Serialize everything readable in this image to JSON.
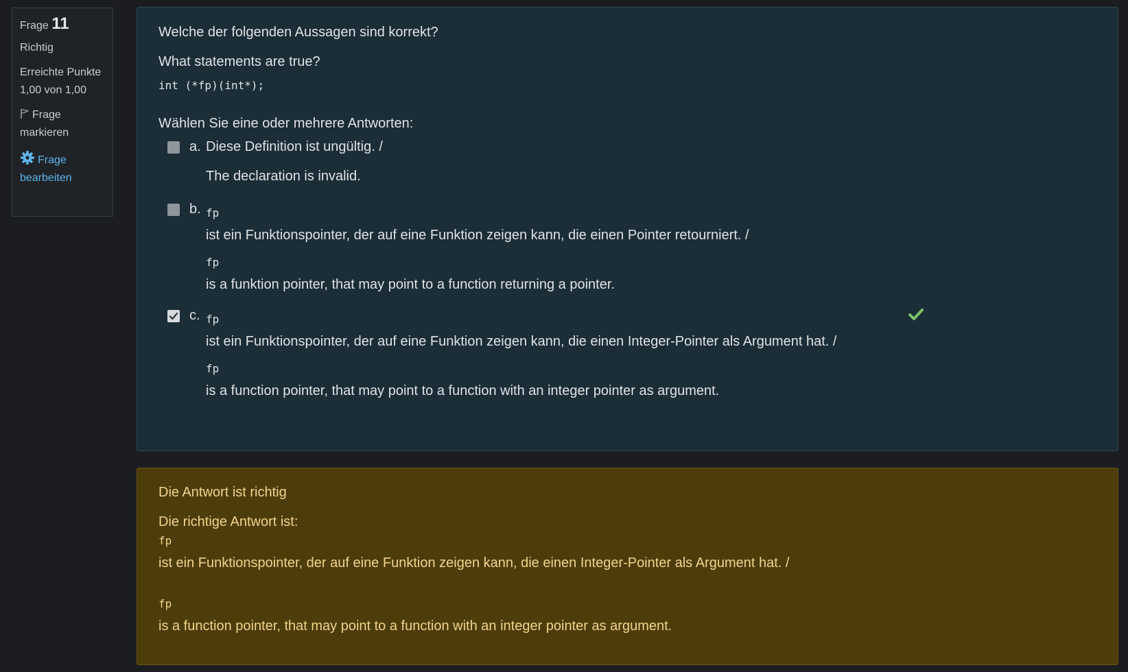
{
  "info": {
    "question_label": "Frage",
    "question_number": "11",
    "state": "Richtig",
    "grade": "Erreichte Punkte 1,00 von 1,00",
    "flag_label": "Frage markieren",
    "edit_label": "Frage bearbeiten"
  },
  "question": {
    "text_de": "Welche der folgenden Aussagen sind korrekt?",
    "text_en": "What statements are true?",
    "code": "int (*fp)(int*);",
    "prompt": "Wählen Sie eine oder mehrere Antworten:",
    "answers": [
      {
        "letter": "a.",
        "checked": false,
        "line_de": "Diese Definition ist ungültig. /",
        "line_en": "The declaration is invalid."
      },
      {
        "letter": "b.",
        "checked": false,
        "code_de": "fp",
        "line_de": "ist ein Funktionspointer, der auf eine Funktion zeigen kann, die einen Pointer retourniert. /",
        "code_en": "fp",
        "line_en": "is a funktion pointer, that may point to a function returning a pointer."
      },
      {
        "letter": "c.",
        "checked": true,
        "correct": true,
        "code_de": "fp",
        "line_de": "ist ein Funktionspointer, der auf eine Funktion zeigen kann, die einen Integer-Pointer als Argument hat. /",
        "code_en": "fp",
        "line_en": "is a function pointer, that may point to a function with an integer pointer as argument."
      }
    ]
  },
  "feedback": {
    "state": "Die Antwort ist richtig",
    "right_answer_label": "Die richtige Antwort ist:",
    "code_de": "fp",
    "line_de": "ist ein Funktionspointer, der auf eine Funktion zeigen kann, die einen Integer-Pointer als Argument hat. /",
    "code_en": "fp",
    "line_en": "is a function pointer, that may point to a function with an integer pointer as argument."
  },
  "colors": {
    "page_bg": "#1b1d20",
    "question_bg": "#1b2d37",
    "feedback_bg": "#4d3d0b",
    "feedback_text": "#f1d48a",
    "link": "#5eb6ef",
    "correct_check": "#7cc36b"
  },
  "icons": [
    "flag-icon",
    "gear-icon",
    "checkbox-icon",
    "correct-check-icon"
  ]
}
